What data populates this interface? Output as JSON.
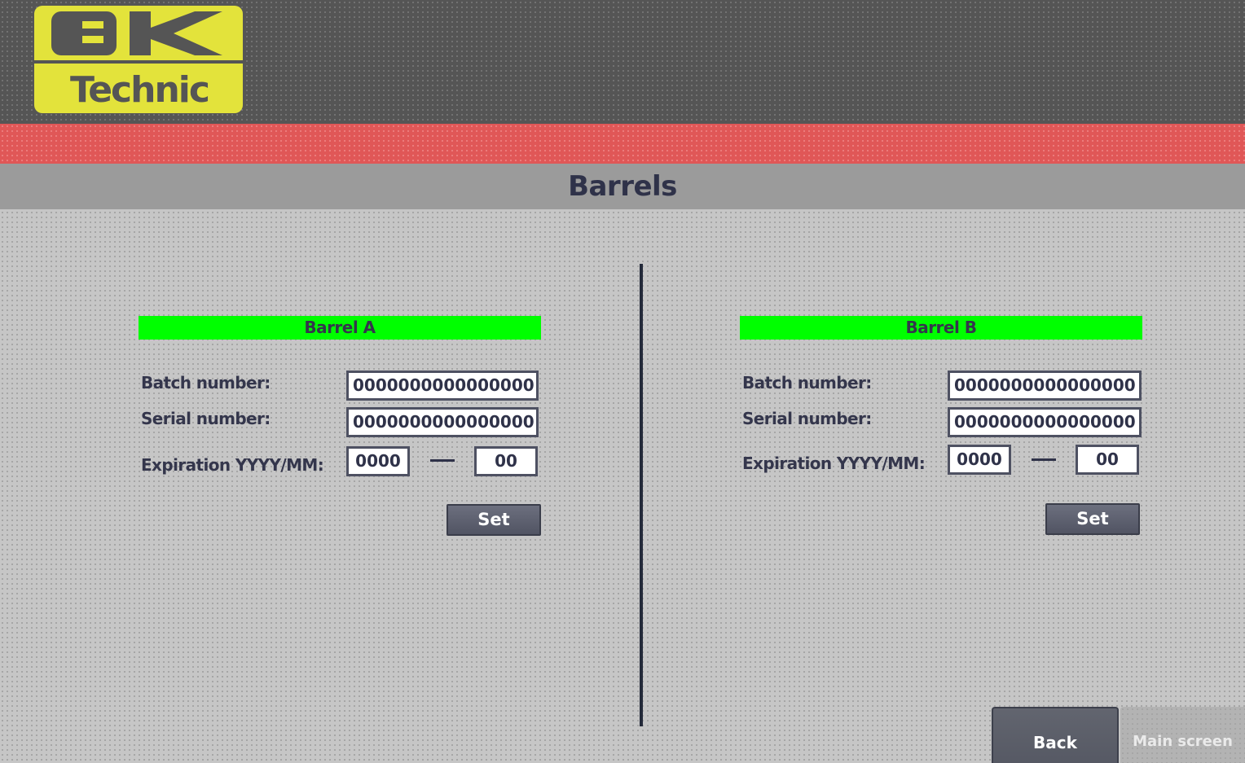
{
  "header": {
    "logo": {
      "top_text": "BK",
      "bottom_text": "Technic"
    },
    "accent_color": "#e05757",
    "logo_color": "#e3e33b"
  },
  "page": {
    "title": "Barrels"
  },
  "barrel_a": {
    "title": "Barrel A",
    "batch_label": "Batch number:",
    "batch_value": "0000000000000000",
    "serial_label": "Serial number:",
    "serial_value": "0000000000000000",
    "expiration_label": "Expiration YYYY/MM:",
    "expiration_year": "0000",
    "expiration_month": "00",
    "set_label": "Set"
  },
  "barrel_b": {
    "title": "Barrel B",
    "batch_label": "Batch number:",
    "batch_value": "0000000000000000",
    "serial_label": "Serial number:",
    "serial_value": "0000000000000000",
    "expiration_label": "Expiration YYYY/MM:",
    "expiration_year": "0000",
    "expiration_month": "00",
    "set_label": "Set"
  },
  "nav": {
    "back_label": "Back",
    "main_label": "Main screen"
  },
  "colors": {
    "panel_header": "#00ff00",
    "text": "#34364c"
  }
}
